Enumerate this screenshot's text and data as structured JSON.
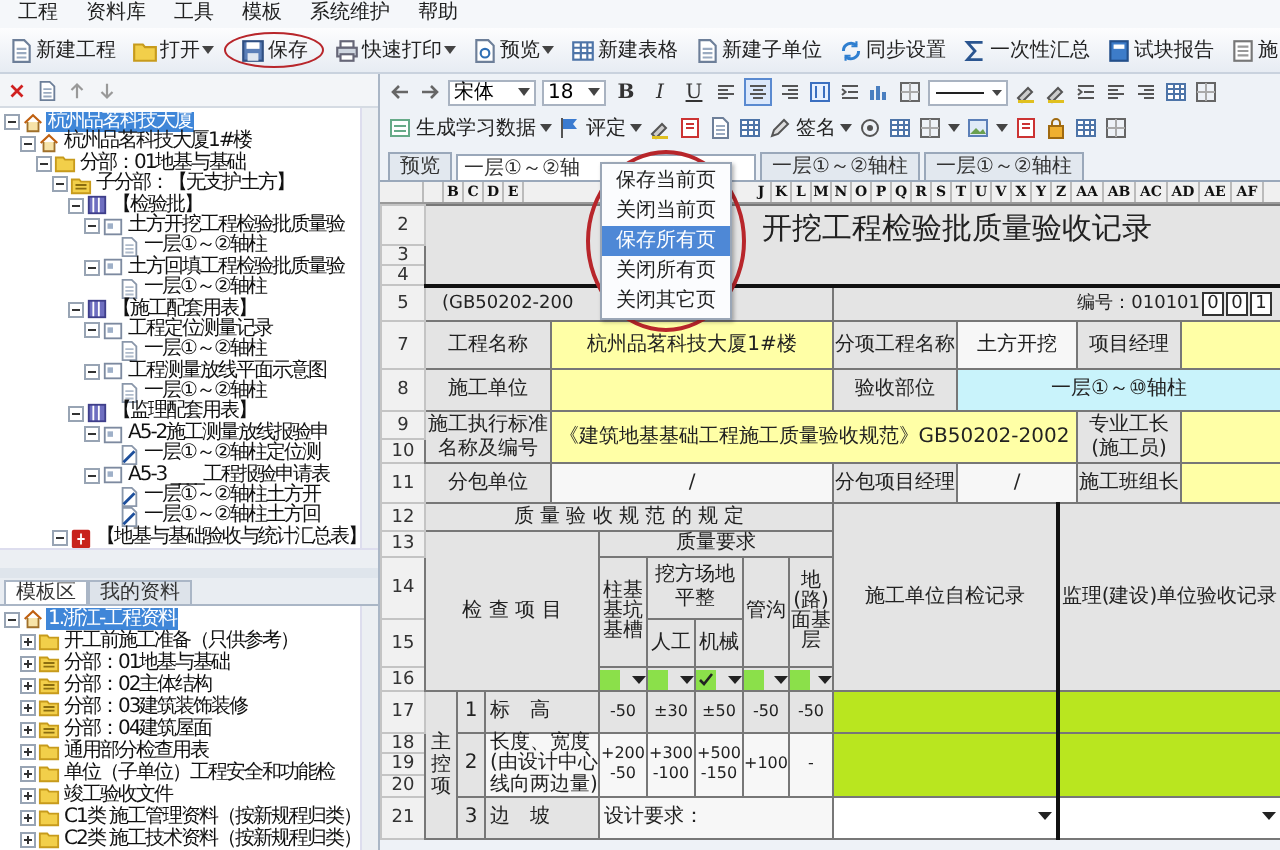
{
  "menu_bar": [
    "工程",
    "资料库",
    "工具",
    "模板",
    "系统维护",
    "帮助"
  ],
  "toolbar": [
    {
      "label": "新建工程",
      "kind": "document",
      "dropdown": false,
      "highlighted": false
    },
    {
      "label": "打开",
      "kind": "folder",
      "dropdown": true,
      "highlighted": false
    },
    {
      "label": "保存",
      "kind": "save",
      "dropdown": false,
      "highlighted": true
    },
    {
      "label": "快速打印",
      "kind": "printer",
      "dropdown": true,
      "highlighted": false
    },
    {
      "label": "预览",
      "kind": "preview",
      "dropdown": true,
      "highlighted": false
    },
    {
      "label": "新建表格",
      "kind": "table",
      "dropdown": false,
      "highlighted": false
    },
    {
      "label": "新建子单位",
      "kind": "document",
      "dropdown": false,
      "highlighted": false
    },
    {
      "label": "同步设置",
      "kind": "sync",
      "dropdown": false,
      "highlighted": false
    },
    {
      "label": "一次性汇总",
      "kind": "sigma",
      "dropdown": false,
      "highlighted": false
    },
    {
      "label": "试块报告",
      "kind": "book",
      "dropdown": false,
      "highlighted": false
    },
    {
      "label": "施",
      "kind": "notepad",
      "dropdown": false,
      "highlighted": false
    }
  ],
  "project_tree": {
    "items": [
      {
        "label": "杭州品茗科技大厦",
        "kind": "house",
        "expanded": true,
        "selected": true,
        "children": [
          {
            "label": "杭州品茗科技大厦1#楼",
            "kind": "house",
            "expanded": true,
            "selected": false,
            "children": [
              {
                "label": "分部：01地基与基础",
                "kind": "folder",
                "expanded": true,
                "selected": false,
                "children": [
                  {
                    "label": "子分部：【无支护土方】",
                    "kind": "section",
                    "expanded": true,
                    "selected": false,
                    "children": [
                      {
                        "label": "【检验批】",
                        "kind": "binder",
                        "expanded": true,
                        "selected": false,
                        "children": [
                          {
                            "label": "土方开挖工程检验批质量验",
                            "kind": "form",
                            "expanded": true,
                            "selected": false,
                            "children": [
                              {
                                "label": "一层①～②轴柱",
                                "kind": "page",
                                "selected": false
                              }
                            ]
                          },
                          {
                            "label": "土方回填工程检验批质量验",
                            "kind": "form",
                            "expanded": true,
                            "selected": false,
                            "children": [
                              {
                                "label": "一层①～②轴柱",
                                "kind": "page",
                                "selected": false
                              }
                            ]
                          }
                        ]
                      },
                      {
                        "label": "【施工配套用表】",
                        "kind": "binder",
                        "expanded": true,
                        "selected": false,
                        "children": [
                          {
                            "label": "工程定位测量记录",
                            "kind": "form",
                            "expanded": true,
                            "selected": false,
                            "children": [
                              {
                                "label": "一层①～②轴柱",
                                "kind": "page",
                                "selected": false
                              }
                            ]
                          },
                          {
                            "label": "工程测量放线平面示意图",
                            "kind": "form",
                            "expanded": true,
                            "selected": false,
                            "children": [
                              {
                                "label": "一层①～②轴柱",
                                "kind": "page",
                                "selected": false
                              }
                            ]
                          }
                        ]
                      },
                      {
                        "label": "【监理配套用表】",
                        "kind": "binder",
                        "expanded": true,
                        "selected": false,
                        "children": [
                          {
                            "label": "A5-2施工测量放线报验申",
                            "kind": "form",
                            "expanded": true,
                            "selected": false,
                            "children": [
                              {
                                "label": "一层①～②轴柱定位测",
                                "kind": "signed",
                                "selected": false
                              }
                            ]
                          },
                          {
                            "label": "A5-3 ____工程报验申请表",
                            "kind": "form",
                            "expanded": true,
                            "selected": false,
                            "children": [
                              {
                                "label": "一层①～②轴柱土方开",
                                "kind": "signed",
                                "selected": false
                              },
                              {
                                "label": "一层①～②轴柱土方回",
                                "kind": "signed",
                                "selected": false
                              }
                            ]
                          }
                        ]
                      }
                    ]
                  },
                  {
                    "label": "【地基与基础验收与统计汇总表】",
                    "kind": "red",
                    "expanded": true,
                    "selected": false
                  }
                ]
              }
            ]
          }
        ]
      }
    ]
  },
  "bottom_tabs": [
    {
      "label": "模板区",
      "selected": true
    },
    {
      "label": "我的资料",
      "selected": false
    }
  ],
  "template_tree": {
    "items": [
      {
        "label": "1.浙江-工程资料",
        "kind": "house",
        "expanded": true,
        "selected": true,
        "children": [
          {
            "label": "开工前施工准备（只供参考）",
            "kind": "folder",
            "expanded": false,
            "selected": false
          },
          {
            "label": "分部：01地基与基础",
            "kind": "section",
            "expanded": false,
            "selected": false
          },
          {
            "label": "分部：02主体结构",
            "kind": "section",
            "expanded": false,
            "selected": false
          },
          {
            "label": "分部：03建筑装饰装修",
            "kind": "section",
            "expanded": false,
            "selected": false
          },
          {
            "label": "分部：04建筑屋面",
            "kind": "section",
            "expanded": false,
            "selected": false
          },
          {
            "label": "通用部分检查用表",
            "kind": "folder",
            "expanded": false,
            "selected": false
          },
          {
            "label": "单位（子单位）工程安全和功能检",
            "kind": "folder",
            "expanded": false,
            "selected": false
          },
          {
            "label": "竣工验收文件",
            "kind": "folder",
            "expanded": false,
            "selected": false
          },
          {
            "label": "C1类 施工管理资料（按新规程归类）",
            "kind": "folder",
            "expanded": false,
            "selected": false
          },
          {
            "label": "C2类 施工技术资料（按新规程归类）",
            "kind": "folder",
            "expanded": false,
            "selected": false
          }
        ]
      }
    ]
  },
  "format_bar": {
    "font": "宋体",
    "size": "18",
    "style_buttons": [
      "B",
      "I",
      "U"
    ]
  },
  "action_bar": [
    {
      "label": "生成学习数据",
      "kind": "learn"
    },
    {
      "label": "评定",
      "kind": "rate"
    },
    {
      "label": "签名",
      "kind": "sign"
    }
  ],
  "sheet_tabs": [
    {
      "label": "预览",
      "selected": false
    },
    {
      "label": "一层①～②轴",
      "selected": true
    },
    {
      "label": "一层①～②轴柱",
      "selected": false
    },
    {
      "label": "一层①～②轴柱",
      "selected": false
    }
  ],
  "context_menu": {
    "highlighted": true,
    "items": [
      {
        "label": "保存当前页",
        "selected": false
      },
      {
        "label": "关闭当前页",
        "selected": false
      },
      {
        "label": "保存所有页",
        "selected": true
      },
      {
        "label": "关闭所有页",
        "selected": false
      },
      {
        "label": "关闭其它页",
        "selected": false
      }
    ]
  },
  "sheet": {
    "column_headers_left": [
      "B",
      "C",
      "D",
      "E"
    ],
    "column_headers_right": [
      "J",
      "K",
      "L",
      "M",
      "N",
      "O",
      "P",
      "Q",
      "R",
      "S",
      "T",
      "U",
      "V",
      "X",
      "Y",
      "Z",
      "AA",
      "AB",
      "AC",
      "AD",
      "AE",
      "AF"
    ],
    "rows": [
      {
        "number": "2",
        "cells": [
          "开挖工程检验批质量验收记录"
        ]
      },
      {
        "number": "3"
      },
      {
        "number": "4"
      },
      {
        "number": "5",
        "cells": [
          "(GB50202-200",
          "编号：010101"
        ],
        "boxes": [
          "0",
          "0",
          "1"
        ]
      },
      {
        "number": "7",
        "cells": [
          "工程名称",
          "杭州品茗科技大厦1#楼",
          "分项工程名称",
          "土方开挖",
          "项目经理"
        ]
      },
      {
        "number": "8",
        "cells": [
          "施工单位",
          "验收部位",
          "一层①～⑩轴柱"
        ]
      },
      {
        "number": "9",
        "cells": [
          "施工执行标准名称及编号",
          "《建筑地基基础工程施工质量验收规范》GB50202-2002",
          "专业工长(施工员)"
        ]
      },
      {
        "number": "10"
      },
      {
        "number": "11",
        "cells": [
          "分包单位",
          "/",
          "分包项目经理",
          "/",
          "施工班组长"
        ]
      },
      {
        "number": "12",
        "cells": [
          "质 量 验 收 规 范 的 规 定",
          "施工单位自检记录",
          "监理(建设)单位验收记录"
        ]
      },
      {
        "number": "13",
        "cells": [
          "检 查 项 目",
          "质量要求"
        ]
      },
      {
        "number": "14",
        "cells": [
          "柱基基坑基槽",
          "挖方场地平整",
          "管沟",
          "地(路)面基层"
        ]
      },
      {
        "number": "15",
        "cells": [
          "人工",
          "机械"
        ]
      },
      {
        "number": "16",
        "checks": [
          {
            "checked": false
          },
          {
            "checked": false
          },
          {
            "checked": true
          },
          {
            "checked": false
          },
          {
            "checked": false
          }
        ]
      },
      {
        "number": "17",
        "cells": [
          "主控项",
          "1",
          "标　高",
          "-50",
          "±30",
          "±50",
          "-50",
          "-50"
        ]
      },
      {
        "number": "18",
        "cells": [
          "2",
          "长度、宽度(由设计中心线向两边量)",
          "+200 -50",
          "+300 -100",
          "+500 -150",
          "+100",
          "-"
        ]
      },
      {
        "number": "19"
      },
      {
        "number": "20"
      },
      {
        "number": "21",
        "cells": [
          "3",
          "边　坡",
          "设计要求："
        ]
      }
    ]
  }
}
